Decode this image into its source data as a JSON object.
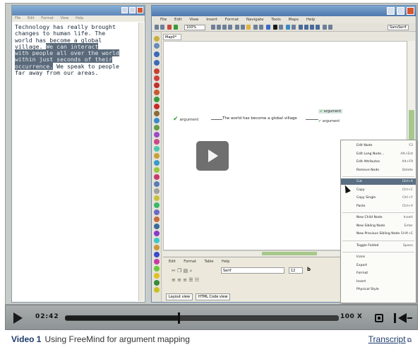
{
  "notepad": {
    "title": "",
    "menu": [
      "File",
      "Edit",
      "Format",
      "View",
      "Help"
    ],
    "lines": [
      {
        "text": "Technology has really brought",
        "hl": false
      },
      {
        "text": "changes to human life. The",
        "hl": false
      },
      {
        "text": "world has become a global",
        "hl": false
      },
      {
        "text": "village. ",
        "hl": false,
        "hl_tail": "We can interact"
      },
      {
        "text": "",
        "hl": true,
        "hl_tail": "with people all over the world"
      },
      {
        "text": "",
        "hl": true,
        "hl_tail": "within just seconds of their"
      },
      {
        "text": "",
        "hl": true,
        "hl_tail": "occurrence.",
        "tail": " We speak to people"
      },
      {
        "text": "far away from our areas.",
        "hl": false
      }
    ]
  },
  "freemind": {
    "title": "",
    "menu": [
      "File",
      "Edit",
      "View",
      "Insert",
      "Format",
      "Navigate",
      "Tools",
      "Maps",
      "Help"
    ],
    "zoom": "100%",
    "font": "SansSerif",
    "tab": "Map0*",
    "nodes": {
      "left": "argument",
      "main": "The world has become a global village",
      "right1": "argument",
      "right2": "argument"
    },
    "note_menu": [
      "Edit",
      "Format",
      "Table",
      "Help"
    ],
    "note_font": "Serif",
    "note_size": "12",
    "note_bold": "b",
    "tabs": [
      "Layout view",
      "HTML Code view"
    ]
  },
  "context_menu": [
    {
      "label": "Edit Node",
      "key": "F2"
    },
    {
      "label": "Edit Long Node...",
      "key": "Alt+Ent"
    },
    {
      "label": "Edit Attributes",
      "key": "Alt+F9"
    },
    {
      "label": "Remove Node",
      "key": "Delete"
    },
    {
      "sep": true
    },
    {
      "label": "Cut",
      "key": "Ctrl+X",
      "selected": true
    },
    {
      "label": "Copy",
      "key": "Ctrl+C"
    },
    {
      "label": "Copy Single",
      "key": "Ctrl+Y"
    },
    {
      "label": "Paste",
      "key": "Ctrl+V"
    },
    {
      "sep": true
    },
    {
      "label": "New Child Node",
      "key": "Insert"
    },
    {
      "label": "New Sibling Node",
      "key": "Enter"
    },
    {
      "label": "New Previous Sibling Node",
      "key": "Shift+E"
    },
    {
      "sep": true
    },
    {
      "label": "Toggle Folded",
      "key": "Space"
    },
    {
      "sep": true
    },
    {
      "label": "Icons",
      "key": ""
    },
    {
      "label": "Export",
      "key": ""
    },
    {
      "label": "Format",
      "key": ""
    },
    {
      "label": "Insert",
      "key": ""
    },
    {
      "label": "Physical Style",
      "key": ""
    }
  ],
  "player": {
    "play_icon": "play-icon",
    "time": "02:42",
    "progress": 0.415,
    "speed": "100 X",
    "fullscreen_icon": "fullscreen-icon",
    "volume_icon": "volume-icon"
  },
  "caption": {
    "label": "Video 1",
    "text": "Using FreeMind for argument mapping",
    "transcript": "Transcript",
    "transcript_icon": "external-link-icon"
  },
  "colors": {
    "accent": "#1d3a6b",
    "highlight": "#5a6a7a",
    "selected": "#5a6f82",
    "scroll_thumb": "#a6c88a"
  }
}
